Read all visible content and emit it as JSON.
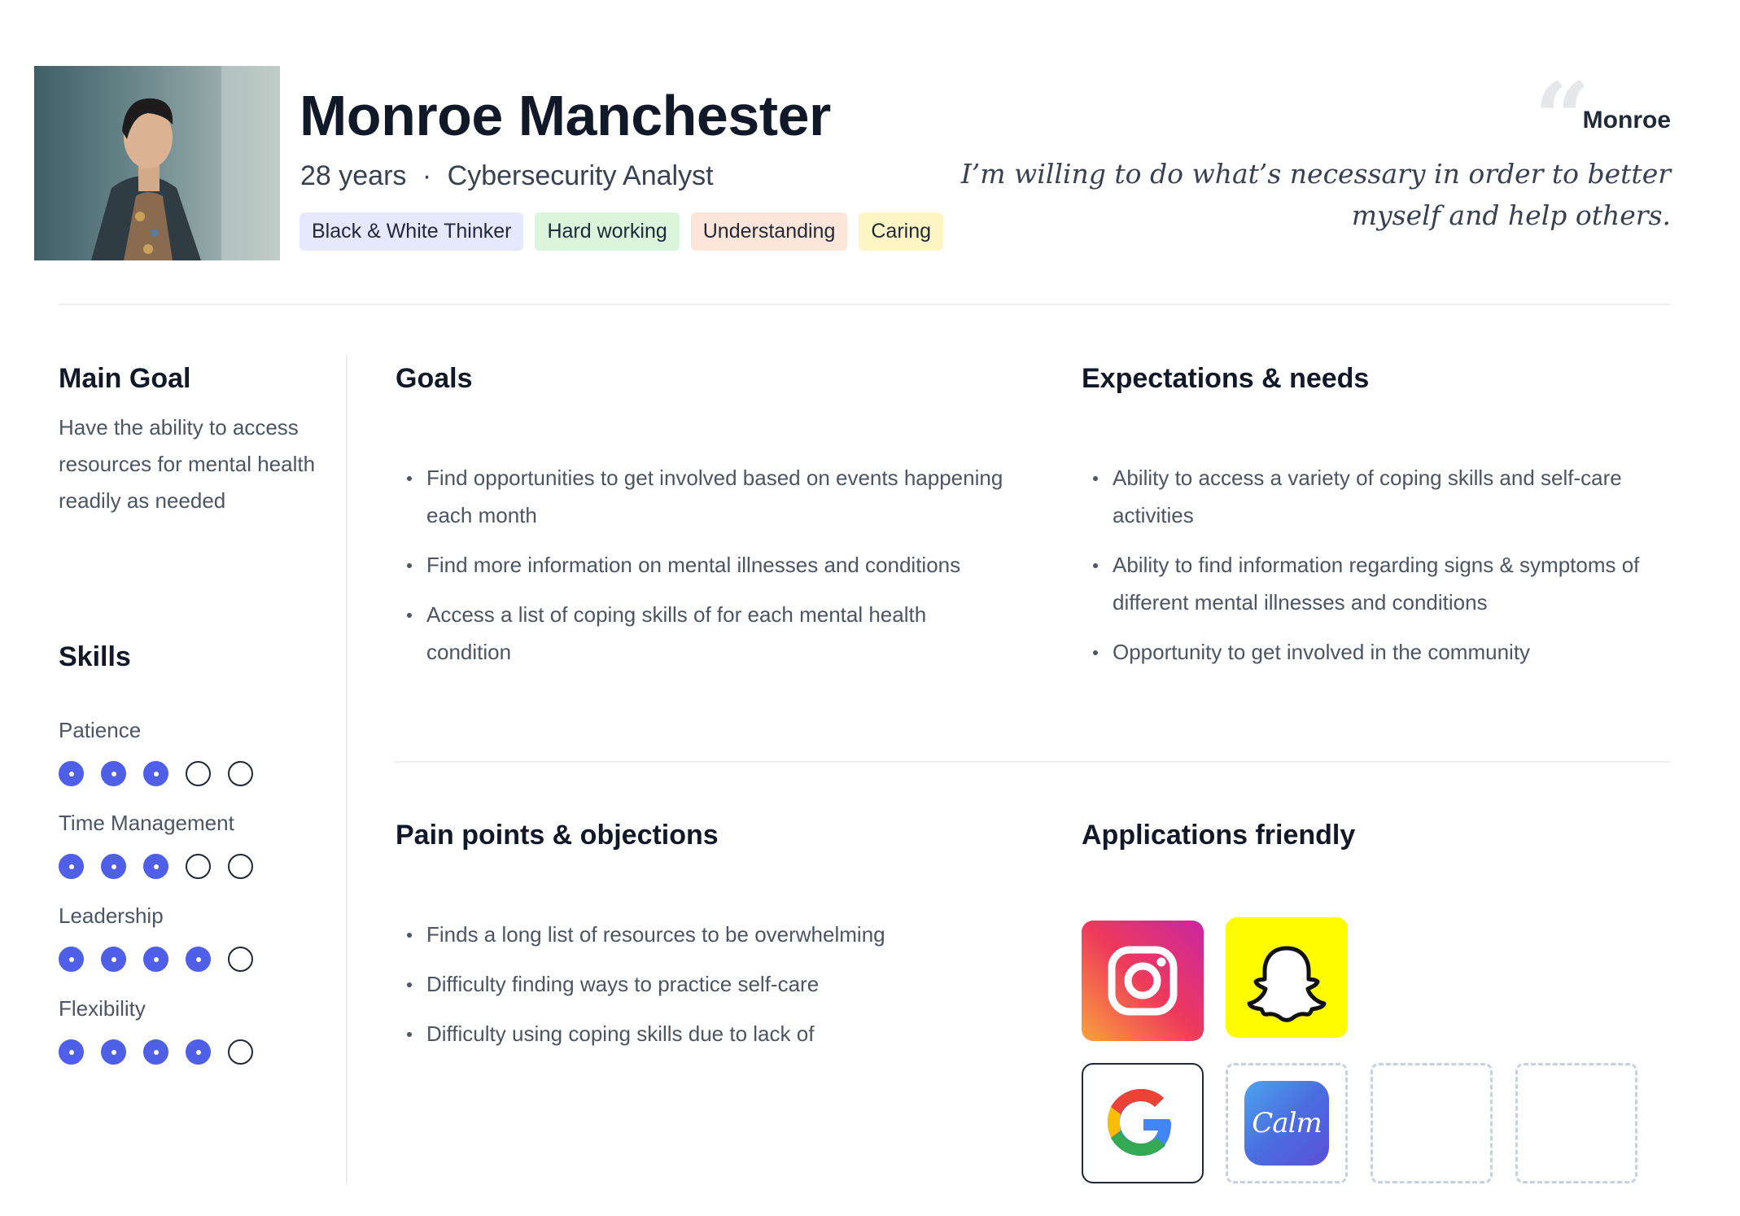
{
  "persona": {
    "name": "Monroe Manchester",
    "age": "28 years",
    "separator": "·",
    "role": "Cybersecurity Analyst",
    "tags": [
      "Black & White Thinker",
      "Hard working",
      "Understanding",
      "Caring"
    ]
  },
  "quote": {
    "mark": "“",
    "author": "Monroe",
    "text": "I’m willing to do what’s necessary in order to better myself and help others."
  },
  "main_goal": {
    "title": "Main Goal",
    "text": "Have the ability to access resources for mental health readily as needed"
  },
  "skills": {
    "title": "Skills",
    "items": [
      {
        "label": "Patience",
        "level": 3,
        "max": 5
      },
      {
        "label": "Time Management",
        "level": 3,
        "max": 5
      },
      {
        "label": "Leadership",
        "level": 4,
        "max": 5
      },
      {
        "label": "Flexibility",
        "level": 4,
        "max": 5
      }
    ]
  },
  "goals": {
    "title": "Goals",
    "items": [
      "Find opportunities to get involved based on events happening each month",
      "Find more information on mental illnesses and conditions",
      "Access a list of coping skills of for each mental health condition"
    ]
  },
  "expectations": {
    "title": "Expectations & needs",
    "items": [
      "Ability to access a variety of coping skills and self-care activities",
      "Ability to find information regarding signs & symptoms of different mental illnesses and conditions",
      "Opportunity to get involved in the community"
    ]
  },
  "pain_points": {
    "title": "Pain points & objections",
    "items": [
      "Finds a long list of resources to be overwhelming",
      "Difficulty finding ways to practice self-care",
      "Difficulty using coping skills due to lack of"
    ]
  },
  "applications": {
    "title": "Applications friendly",
    "apps": [
      "instagram-icon",
      "snapchat-icon",
      "google-icon",
      "calm-icon",
      "empty-slot",
      "empty-slot"
    ],
    "calm_label": "Calm"
  },
  "colors": {
    "accent": "#4f5fe8",
    "instagram_start": "#f9a13c",
    "instagram_end": "#c926a0",
    "snapchat": "#fffc00"
  }
}
